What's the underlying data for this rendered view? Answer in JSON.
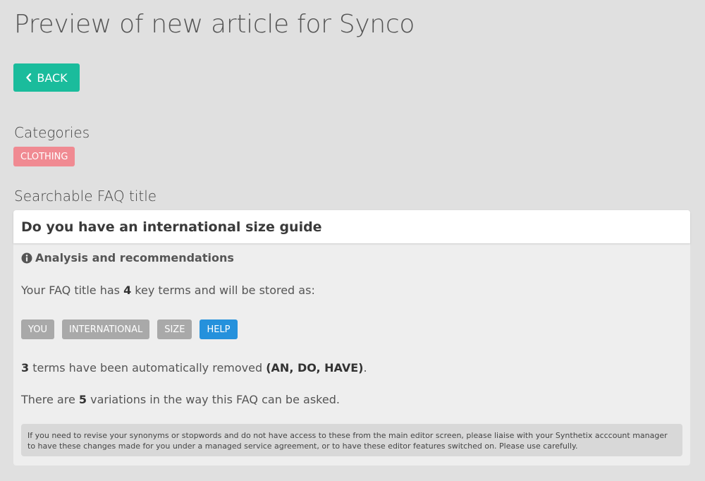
{
  "page": {
    "title": "Preview of new article for Synco"
  },
  "toolbar": {
    "back_label": "BACK"
  },
  "categories": {
    "heading": "Categories",
    "items": [
      "CLOTHING"
    ],
    "badge_color": "#f08a92"
  },
  "faq": {
    "heading": "Searchable FAQ title",
    "title": "Do you have an international size guide"
  },
  "analysis": {
    "heading": "Analysis and recommendations",
    "key_terms_prefix": "Your FAQ title has ",
    "key_terms_count": "4",
    "key_terms_suffix": " key terms and will be stored as:",
    "terms": [
      {
        "label": "YOU",
        "color": "#a9a9a9"
      },
      {
        "label": "INTERNATIONAL",
        "color": "#a9a9a9"
      },
      {
        "label": "SIZE",
        "color": "#a9a9a9"
      },
      {
        "label": "HELP",
        "color": "#2591dc"
      }
    ],
    "removed_count": "3",
    "removed_mid": " terms have been automatically removed ",
    "removed_list": "(AN, DO, HAVE)",
    "removed_end": ".",
    "variations_prefix": "There are ",
    "variations_count": "5",
    "variations_suffix": " variations in the way this FAQ can be asked.",
    "note": "If you need to revise your synonyms or stopwords and do not have access to these from the main editor screen, please liaise with your Synthetix acccount manager to have these changes made for you under a managed service agreement, or to have these editor features switched on. Please use carefully."
  },
  "colors": {
    "accent": "#1abc9c",
    "background": "#e0e0e0"
  }
}
